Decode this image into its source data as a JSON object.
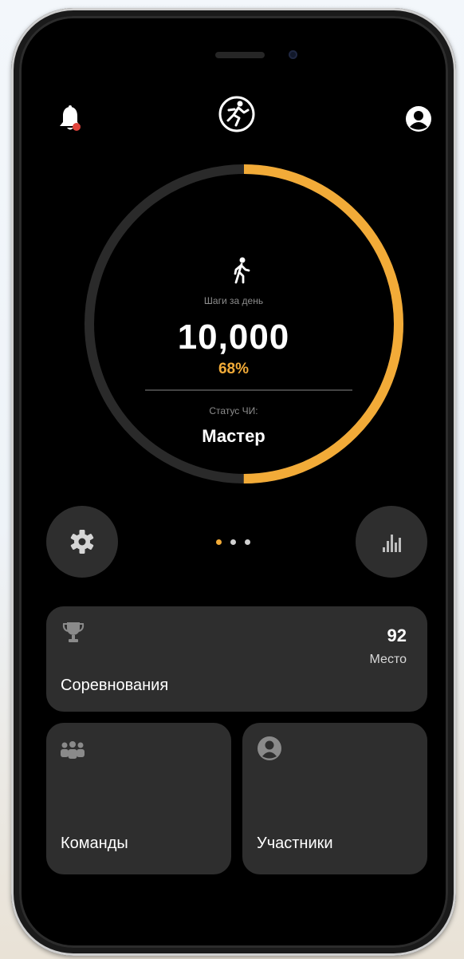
{
  "colors": {
    "accent": "#f2ab38",
    "background": "#000000",
    "card": "#2e2e2e",
    "track": "#2a2a2a"
  },
  "header": {
    "left_icon": "bell-icon",
    "center_icon": "runner-logo-icon",
    "right_icon": "user-icon"
  },
  "progress": {
    "fraction": 0.5,
    "icon": "walking-person-icon",
    "steps_label": "Шаги за день",
    "steps_value": "10,000",
    "percent": "68%",
    "status_label": "Статус ЧИ:",
    "status_value": "Мастер"
  },
  "controls": {
    "left_icon": "settings-icon",
    "right_icon": "bar-chart-icon",
    "pages": 3,
    "active_page": 0
  },
  "cards": {
    "competitions": {
      "label": "Соревнования",
      "icon": "trophy-icon",
      "place_value": "92",
      "place_label": "Место"
    },
    "teams": {
      "label": "Команды",
      "icon": "team-icon"
    },
    "members": {
      "label": "Участники",
      "icon": "person-icon"
    }
  }
}
